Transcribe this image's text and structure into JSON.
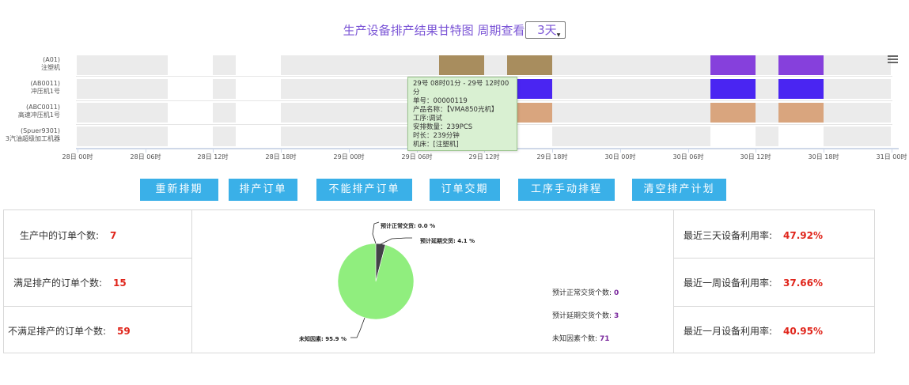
{
  "header": {
    "title": "生产设备排产结果甘特图 周期查看",
    "period_value": "3天"
  },
  "gantt": {
    "rows": [
      {
        "code": "(A01)",
        "name": "注塑机"
      },
      {
        "code": "(AB0011)",
        "name": "冲压机1号"
      },
      {
        "code": "(ABC0011)",
        "name": "高速冲压机1号"
      },
      {
        "code": "(Spuer9301)",
        "name": "3汽油超级加工机器"
      }
    ],
    "axis_ticks": [
      "28日 00时",
      "28日 06时",
      "28日 12时",
      "28日 18时",
      "29日 00时",
      "29日 06时",
      "29日 12时",
      "29日 18时",
      "30日 00时",
      "30日 06时",
      "30日 12时",
      "30日 18时",
      "31日 00时"
    ],
    "colors": {
      "idle": "#ebebeb",
      "brown": "#a88d5e",
      "purple": "#8640dc",
      "blue": "#4a25f2",
      "tan": "#d9a57e"
    },
    "tooltip": {
      "line1": "29号 08时01分 - 29号 12时00分",
      "line2": "单号：00000119",
      "line3": "产品名称：【VMA850光机】",
      "line4": "工序:调试",
      "line5": "安排数量：239PCS",
      "line6": "时长：239分钟",
      "line7": "机床：[注塑机]"
    },
    "menu_icon": "hamburger-menu-icon"
  },
  "buttons": {
    "reschedule": "重新排期",
    "schedule_orders": "排产订单",
    "unschedulable_orders": "不能排产订单",
    "order_delivery": "订单交期",
    "manual_process": "工序手动排程",
    "clear_plan": "清空排产计划"
  },
  "stats": {
    "in_production_label": "生产中的订单个数:",
    "in_production_value": "7",
    "satisfied_label": "满足排产的订单个数:",
    "satisfied_value": "15",
    "unsatisfied_label": "不满足排产的订单个数:",
    "unsatisfied_value": "59",
    "util_3day_label": "最近三天设备利用率:",
    "util_3day_value": "47.92%",
    "util_week_label": "最近一周设备利用率:",
    "util_week_value": "37.66%",
    "util_month_label": "最近一月设备利用率:",
    "util_month_value": "40.95%"
  },
  "pie": {
    "labels": {
      "normal": "预计正常交货: 0.0 %",
      "delayed": "预计延期交货: 4.1 %",
      "unknown": "未知因素: 95.9 %"
    },
    "legend": {
      "normal_label": "预计正常交货个数:",
      "normal_value": "0",
      "delayed_label": "预计延期交货个数:",
      "delayed_value": "3",
      "unknown_label": "未知因素个数:",
      "unknown_value": "71"
    },
    "colors": {
      "unknown": "#90ee7e",
      "delayed": "#434348",
      "normal": "#7cb5ec"
    }
  },
  "chart_data": {
    "type": "pie",
    "categories": [
      "预计正常交货",
      "预计延期交货",
      "未知因素"
    ],
    "values": [
      0.0,
      4.1,
      95.9
    ],
    "counts": [
      0,
      3,
      71
    ]
  }
}
